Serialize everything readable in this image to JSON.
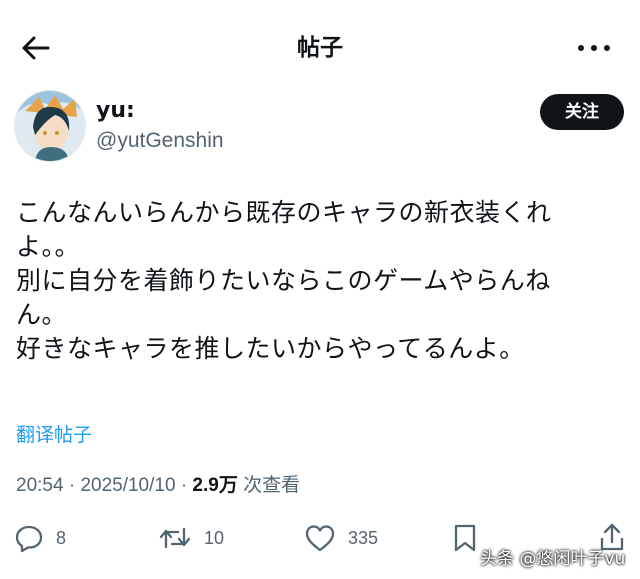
{
  "header": {
    "title": "帖子",
    "back_icon": "arrow-left-icon",
    "more_icon": "more-horizontal-icon"
  },
  "author": {
    "display_name": "yu:",
    "handle": "@yutGenshin",
    "follow_label": "关注"
  },
  "post": {
    "lines": [
      "こんなんいらんから既存のキャラの新衣装くれ",
      "よ。。",
      "別に自分を着飾りたいならこのゲームやらんね",
      "ん。",
      "好きなキャラを推したいからやってるんよ。"
    ],
    "translate_label": "翻译帖子"
  },
  "meta": {
    "time": "20:54",
    "separator": "·",
    "date": "2025/10/10",
    "views": "2.9万",
    "views_label": "次查看"
  },
  "actions": {
    "replies": "8",
    "reposts": "10",
    "likes": "335"
  },
  "watermark": "头条 @悠闲叶子vu",
  "colors": {
    "link": "#1d9bf0",
    "muted": "#536471",
    "text": "#0f1419",
    "button": "#0f1419"
  }
}
